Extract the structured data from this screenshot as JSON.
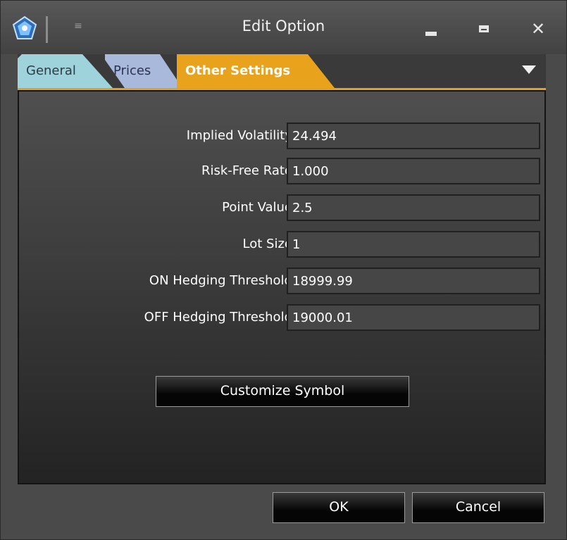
{
  "window": {
    "title": "Edit Option",
    "quick_access_glyph": "≡"
  },
  "tabs": [
    {
      "label": "General"
    },
    {
      "label": "Prices"
    },
    {
      "label": "Other Settings",
      "active": true
    }
  ],
  "fields": [
    {
      "label": "Implied Volatility",
      "value": "24.494"
    },
    {
      "label": "Risk-Free Rate",
      "value": "1.000"
    },
    {
      "label": "Point Value",
      "value": "2.5"
    },
    {
      "label": "Lot Size",
      "value": "1"
    },
    {
      "label": "ON Hedging Threshold",
      "value": "18999.99"
    },
    {
      "label": "OFF Hedging Threshold",
      "value": "19000.01"
    }
  ],
  "buttons": {
    "customize_symbol": "Customize Symbol",
    "ok": "OK",
    "cancel": "Cancel",
    "close_glyph": "✕"
  },
  "colors": {
    "accent": "#e9a21b",
    "tab_general": "#9fd3dc",
    "tab_prices": "#a9b9dc"
  }
}
